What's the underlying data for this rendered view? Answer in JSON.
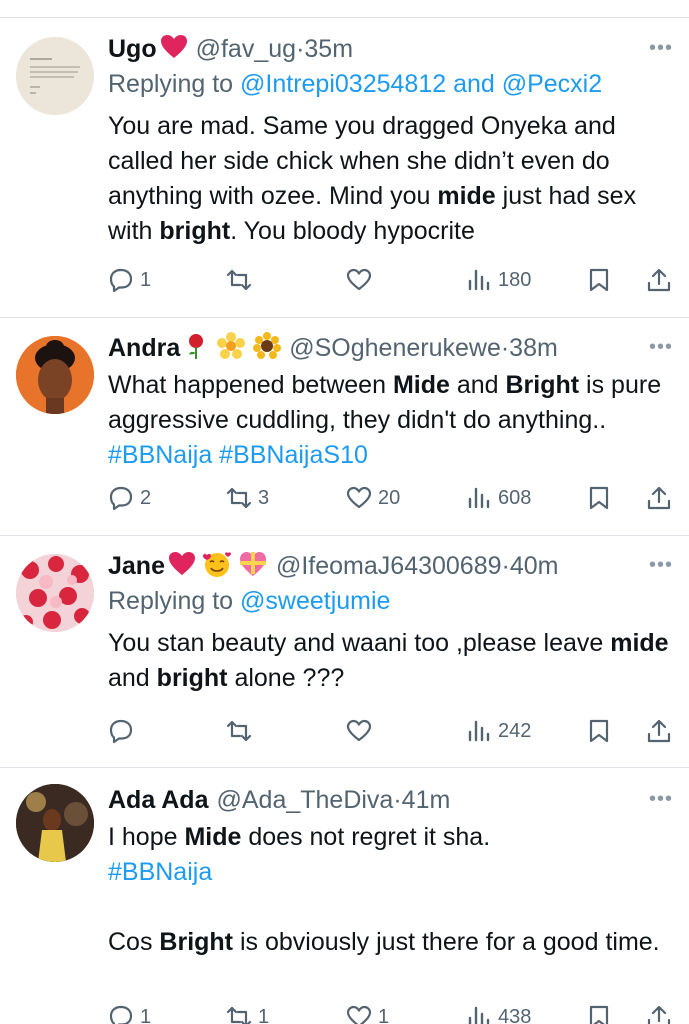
{
  "tweets": [
    {
      "name": "Ugo",
      "emojis": [
        "heart"
      ],
      "handle": "@fav_ug",
      "time": "35m",
      "reply_prefix": "Replying to",
      "reply_to": "@Intrepi03254812 and @Pecxi2",
      "text_parts": [
        {
          "t": "You are mad. Same you dragged Onyeka and called her side chick when she didn’t even do anything with ozee. Mind you ",
          "b": false
        },
        {
          "t": "mide",
          "b": true
        },
        {
          "t": " just had sex with ",
          "b": false
        },
        {
          "t": "bright",
          "b": true
        },
        {
          "t": ". You bloody hypocrite",
          "b": false
        }
      ],
      "replies": "1",
      "retweets": "",
      "likes": "",
      "views": "180"
    },
    {
      "name": "Andra",
      "emojis": [
        "rose",
        "blossom",
        "sunflower"
      ],
      "handle": "@SOgheneruke​we",
      "time": "38m",
      "reply_prefix": "",
      "reply_to": "",
      "text_parts": [
        {
          "t": "What happened between ",
          "b": false
        },
        {
          "t": "Mide",
          "b": true
        },
        {
          "t": " and ",
          "b": false
        },
        {
          "t": "Bright",
          "b": true
        },
        {
          "t": " is pure aggressive cuddling, they didn't do anything.. ",
          "b": false
        },
        {
          "t": "#BBNaija #BBNaijaS10",
          "b": false,
          "tag": true
        }
      ],
      "replies": "2",
      "retweets": "3",
      "likes": "20",
      "views": "608"
    },
    {
      "name": "Jane",
      "emojis": [
        "heart",
        "smiling-face-hearts",
        "heart-ribbon"
      ],
      "handle": "@IfeomaJ64300689",
      "time": "40m",
      "reply_prefix": "Replying to",
      "reply_to": "@sweetjumie",
      "text_parts": [
        {
          "t": "You stan beauty and waani too ,please leave ",
          "b": false
        },
        {
          "t": "mide",
          "b": true
        },
        {
          "t": " and ",
          "b": false
        },
        {
          "t": "bright",
          "b": true
        },
        {
          "t": " alone ???",
          "b": false
        }
      ],
      "replies": "",
      "retweets": "",
      "likes": "",
      "views": "242"
    },
    {
      "name": "Ada Ada",
      "emojis": [],
      "handle": "@Ada_TheDiva",
      "time": "41m",
      "reply_prefix": "",
      "reply_to": "",
      "text_parts": [
        {
          "t": "I hope ",
          "b": false
        },
        {
          "t": "Mide",
          "b": true
        },
        {
          "t": " does not regret it sha.",
          "b": false
        },
        {
          "t": "\n",
          "b": false
        },
        {
          "t": "#BBNaija",
          "b": false,
          "tag": true
        },
        {
          "t": "\n\n",
          "b": false
        },
        {
          "t": "Cos ",
          "b": false
        },
        {
          "t": "Bright",
          "b": true
        },
        {
          "t": " is obviously just there for a good time.",
          "b": false
        }
      ],
      "replies": "1",
      "retweets": "1",
      "likes": "1",
      "views": "438"
    }
  ],
  "colors": {
    "text": "#0f1419",
    "secondary": "#536471",
    "link": "#1d9bf0",
    "heart": "#e0245e",
    "divider": "#dde3e8"
  }
}
